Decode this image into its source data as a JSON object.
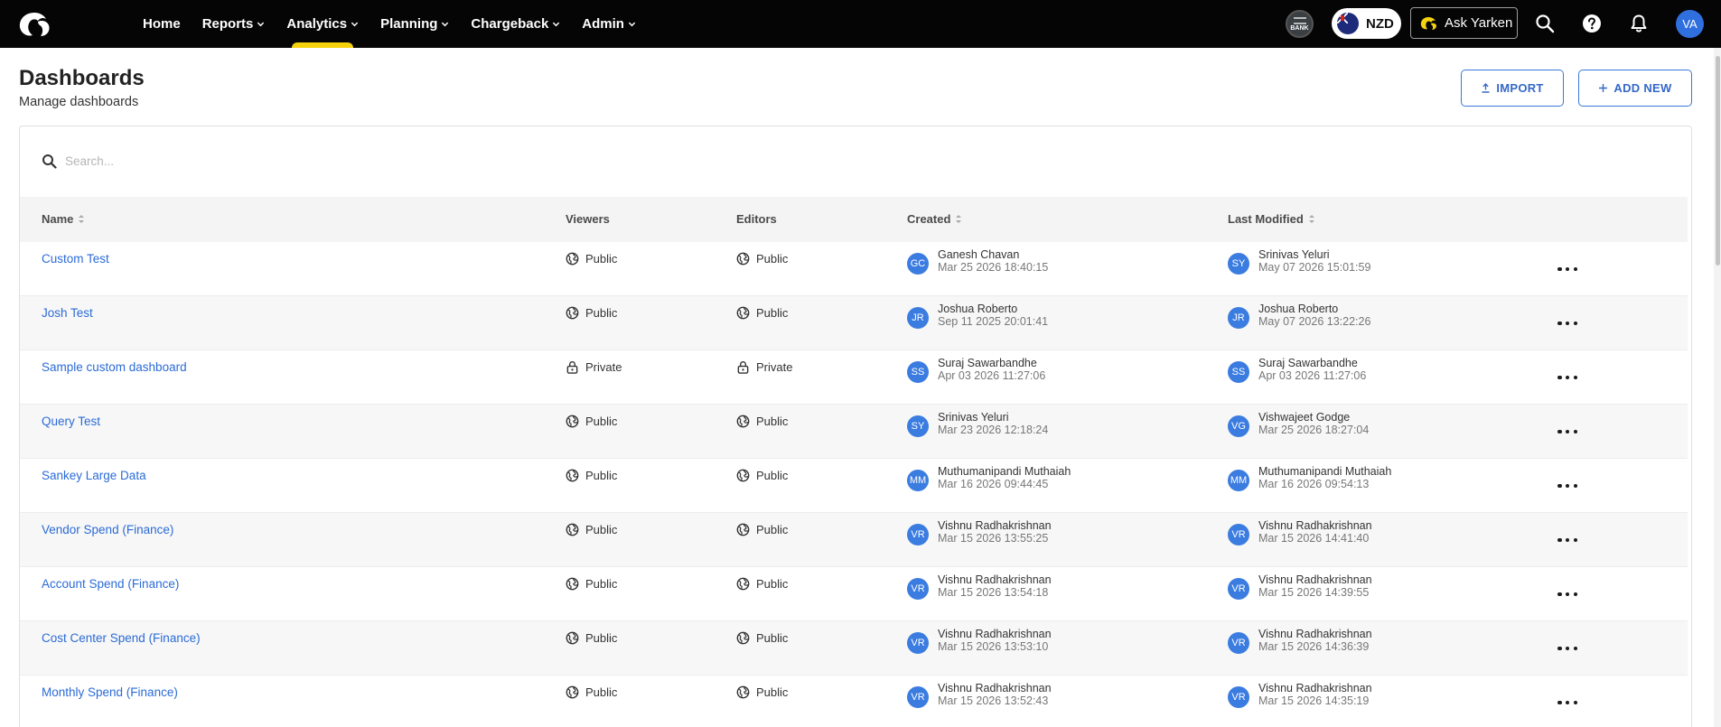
{
  "nav": {
    "items": [
      {
        "label": "Home",
        "has_menu": false,
        "active": false
      },
      {
        "label": "Reports",
        "has_menu": true,
        "active": false
      },
      {
        "label": "Analytics",
        "has_menu": true,
        "active": true
      },
      {
        "label": "Planning",
        "has_menu": true,
        "active": false
      },
      {
        "label": "Chargeback",
        "has_menu": true,
        "active": false
      },
      {
        "label": "Admin",
        "has_menu": true,
        "active": false
      }
    ],
    "bank_label": "BANK",
    "currency": "NZD",
    "ask_label": "Ask Yarken",
    "user_initials": "VA",
    "accent_color": "#f5d20c"
  },
  "header": {
    "title": "Dashboards",
    "subtitle": "Manage dashboards",
    "import_label": "IMPORT",
    "add_new_label": "ADD NEW"
  },
  "search": {
    "placeholder": "Search..."
  },
  "table": {
    "columns": {
      "name": "Name",
      "viewers": "Viewers",
      "editors": "Editors",
      "created": "Created",
      "modified": "Last Modified"
    },
    "rows": [
      {
        "name": "Custom Test",
        "viewers": "Public",
        "editors": "Public",
        "created": {
          "initials": "GC",
          "user": "Ganesh Chavan",
          "date": "Mar 25 2026 18:40:15"
        },
        "modified": {
          "initials": "SY",
          "user": "Srinivas Yeluri",
          "date": "May 07 2026 15:01:59"
        }
      },
      {
        "name": "Josh Test",
        "viewers": "Public",
        "editors": "Public",
        "created": {
          "initials": "JR",
          "user": "Joshua Roberto",
          "date": "Sep 11 2025 20:01:41"
        },
        "modified": {
          "initials": "JR",
          "user": "Joshua Roberto",
          "date": "May 07 2026 13:22:26"
        }
      },
      {
        "name": "Sample custom dashboard",
        "viewers": "Private",
        "editors": "Private",
        "created": {
          "initials": "SS",
          "user": "Suraj Sawarbandhe",
          "date": "Apr 03 2026 11:27:06"
        },
        "modified": {
          "initials": "SS",
          "user": "Suraj Sawarbandhe",
          "date": "Apr 03 2026 11:27:06"
        }
      },
      {
        "name": "Query Test",
        "viewers": "Public",
        "editors": "Public",
        "created": {
          "initials": "SY",
          "user": "Srinivas Yeluri",
          "date": "Mar 23 2026 12:18:24"
        },
        "modified": {
          "initials": "VG",
          "user": "Vishwajeet Godge",
          "date": "Mar 25 2026 18:27:04"
        }
      },
      {
        "name": "Sankey Large Data",
        "viewers": "Public",
        "editors": "Public",
        "created": {
          "initials": "MM",
          "user": "Muthumanipandi Muthaiah",
          "date": "Mar 16 2026 09:44:45"
        },
        "modified": {
          "initials": "MM",
          "user": "Muthumanipandi Muthaiah",
          "date": "Mar 16 2026 09:54:13"
        }
      },
      {
        "name": "Vendor Spend (Finance)",
        "viewers": "Public",
        "editors": "Public",
        "created": {
          "initials": "VR",
          "user": "Vishnu Radhakrishnan",
          "date": "Mar 15 2026 13:55:25"
        },
        "modified": {
          "initials": "VR",
          "user": "Vishnu Radhakrishnan",
          "date": "Mar 15 2026 14:41:40"
        }
      },
      {
        "name": "Account Spend (Finance)",
        "viewers": "Public",
        "editors": "Public",
        "created": {
          "initials": "VR",
          "user": "Vishnu Radhakrishnan",
          "date": "Mar 15 2026 13:54:18"
        },
        "modified": {
          "initials": "VR",
          "user": "Vishnu Radhakrishnan",
          "date": "Mar 15 2026 14:39:55"
        }
      },
      {
        "name": "Cost Center Spend (Finance)",
        "viewers": "Public",
        "editors": "Public",
        "created": {
          "initials": "VR",
          "user": "Vishnu Radhakrishnan",
          "date": "Mar 15 2026 13:53:10"
        },
        "modified": {
          "initials": "VR",
          "user": "Vishnu Radhakrishnan",
          "date": "Mar 15 2026 14:36:39"
        }
      },
      {
        "name": "Monthly Spend (Finance)",
        "viewers": "Public",
        "editors": "Public",
        "created": {
          "initials": "VR",
          "user": "Vishnu Radhakrishnan",
          "date": "Mar 15 2026 13:52:43"
        },
        "modified": {
          "initials": "VR",
          "user": "Vishnu Radhakrishnan",
          "date": "Mar 15 2026 14:35:19"
        }
      }
    ]
  },
  "colors": {
    "nav_bg": "#050505",
    "link": "#2b6bd6",
    "avatar": "#3b7ce0",
    "button_border": "#3a78d8"
  }
}
